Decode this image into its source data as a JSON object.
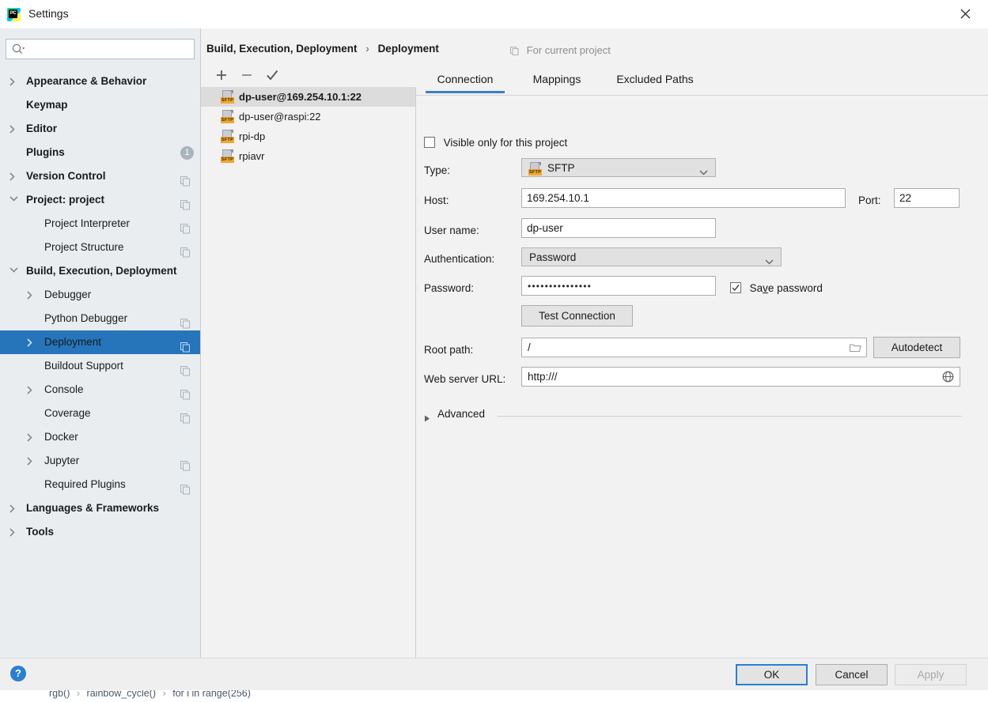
{
  "window": {
    "title": "Settings",
    "logo_icon": "pycharm-logo-icon",
    "close_icon": "close-icon"
  },
  "background_editor": {
    "breadcrumb_parts": [
      "rgb()",
      "rainbow_cycle()",
      "for i in range(256)"
    ],
    "separator": "›"
  },
  "sidebar": {
    "search": {
      "placeholder": "",
      "value": "",
      "icon": "search-icon"
    },
    "items": [
      {
        "label": "Appearance & Behavior",
        "indent": 0,
        "bold": true,
        "arrow": "right",
        "copy": false,
        "badge": null,
        "selected": false
      },
      {
        "label": "Keymap",
        "indent": 0,
        "bold": true,
        "arrow": "none",
        "copy": false,
        "badge": null,
        "selected": false
      },
      {
        "label": "Editor",
        "indent": 0,
        "bold": true,
        "arrow": "right",
        "copy": false,
        "badge": null,
        "selected": false
      },
      {
        "label": "Plugins",
        "indent": 0,
        "bold": true,
        "arrow": "none",
        "copy": false,
        "badge": "1",
        "selected": false
      },
      {
        "label": "Version Control",
        "indent": 0,
        "bold": true,
        "arrow": "right",
        "copy": true,
        "badge": null,
        "selected": false
      },
      {
        "label": "Project: project",
        "indent": 0,
        "bold": true,
        "arrow": "down",
        "copy": true,
        "badge": null,
        "selected": false
      },
      {
        "label": "Project Interpreter",
        "indent": 1,
        "bold": false,
        "arrow": "none",
        "copy": true,
        "badge": null,
        "selected": false
      },
      {
        "label": "Project Structure",
        "indent": 1,
        "bold": false,
        "arrow": "none",
        "copy": true,
        "badge": null,
        "selected": false
      },
      {
        "label": "Build, Execution, Deployment",
        "indent": 0,
        "bold": true,
        "arrow": "down",
        "copy": false,
        "badge": null,
        "selected": false
      },
      {
        "label": "Debugger",
        "indent": 1,
        "bold": false,
        "arrow": "right",
        "copy": false,
        "badge": null,
        "selected": false
      },
      {
        "label": "Python Debugger",
        "indent": 1,
        "bold": false,
        "arrow": "none",
        "copy": true,
        "badge": null,
        "selected": false
      },
      {
        "label": "Deployment",
        "indent": 1,
        "bold": false,
        "arrow": "right",
        "copy": true,
        "badge": null,
        "selected": true
      },
      {
        "label": "Buildout Support",
        "indent": 1,
        "bold": false,
        "arrow": "none",
        "copy": true,
        "badge": null,
        "selected": false
      },
      {
        "label": "Console",
        "indent": 1,
        "bold": false,
        "arrow": "right",
        "copy": true,
        "badge": null,
        "selected": false
      },
      {
        "label": "Coverage",
        "indent": 1,
        "bold": false,
        "arrow": "none",
        "copy": true,
        "badge": null,
        "selected": false
      },
      {
        "label": "Docker",
        "indent": 1,
        "bold": false,
        "arrow": "right",
        "copy": false,
        "badge": null,
        "selected": false
      },
      {
        "label": "Jupyter",
        "indent": 1,
        "bold": false,
        "arrow": "right",
        "copy": true,
        "badge": null,
        "selected": false
      },
      {
        "label": "Required Plugins",
        "indent": 1,
        "bold": false,
        "arrow": "none",
        "copy": true,
        "badge": null,
        "selected": false
      },
      {
        "label": "Languages & Frameworks",
        "indent": 0,
        "bold": true,
        "arrow": "right",
        "copy": false,
        "badge": null,
        "selected": false
      },
      {
        "label": "Tools",
        "indent": 0,
        "bold": true,
        "arrow": "right",
        "copy": false,
        "badge": null,
        "selected": false
      }
    ]
  },
  "content": {
    "breadcrumb": {
      "root": "Build, Execution, Deployment",
      "separator": "›",
      "current": "Deployment"
    },
    "for_current_project": "For current project",
    "server_toolbar": [
      {
        "name": "add-server-button",
        "icon": "plus-icon"
      },
      {
        "name": "remove-server-button",
        "icon": "minus-icon"
      },
      {
        "name": "set-default-button",
        "icon": "checkmark-icon"
      }
    ],
    "servers": [
      {
        "name": "dp-user@169.254.10.1:22",
        "icon": "sftp-icon",
        "type_tag": "SFTP",
        "selected": true
      },
      {
        "name": "dp-user@raspi:22",
        "icon": "sftp-icon",
        "type_tag": "SFTP",
        "selected": false
      },
      {
        "name": "rpi-dp",
        "icon": "sftp-icon",
        "type_tag": "SFTP",
        "selected": false
      },
      {
        "name": "rpiavr",
        "icon": "sftp-icon",
        "type_tag": "SFTP",
        "selected": false
      }
    ],
    "tabs": [
      {
        "label": "Connection",
        "active": true
      },
      {
        "label": "Mappings",
        "active": false
      },
      {
        "label": "Excluded Paths",
        "active": false
      }
    ],
    "form": {
      "visible_only_checkbox": {
        "label": "Visible only for this project",
        "checked": false
      },
      "type": {
        "label": "Type:",
        "value": "SFTP",
        "icon": "sftp-icon",
        "type_tag": "SFTP"
      },
      "host": {
        "label": "Host:",
        "value": "169.254.10.1"
      },
      "port": {
        "label": "Port:",
        "value": "22"
      },
      "username": {
        "label": "User name:",
        "value": "dp-user"
      },
      "auth": {
        "label": "Authentication:",
        "value": "Password"
      },
      "password": {
        "label": "Password:",
        "value": "•••••••••••••••"
      },
      "save_password_checkbox": {
        "label_before": "Sa",
        "label_mnemonic": "v",
        "label_after": "e password",
        "checked": true
      },
      "test_connection_button": "Test Connection",
      "root_path": {
        "label": "Root path:",
        "value": "/",
        "browse_icon": "folder-icon"
      },
      "autodetect_button": "Autodetect",
      "web_server_url": {
        "label": "Web server URL:",
        "value": "http:///",
        "open_icon": "globe-icon"
      },
      "advanced": {
        "label": "Advanced",
        "expanded": false,
        "icon": "triangle-right-icon"
      }
    }
  },
  "footer": {
    "help_button": "?",
    "help_icon": "help-icon",
    "ok_button": "OK",
    "cancel_button": "Cancel",
    "apply_button": "Apply",
    "apply_disabled": true
  },
  "colors": {
    "accent_blue": "#2675bb",
    "tab_underline": "#3c7fc1",
    "selection_gray": "#dcdcdc",
    "sidebar_bg": "#e9edf0",
    "content_bg": "#f2f2f2",
    "sftp_tag_orange": "#f0a732",
    "help_blue": "#2a7fd4"
  }
}
